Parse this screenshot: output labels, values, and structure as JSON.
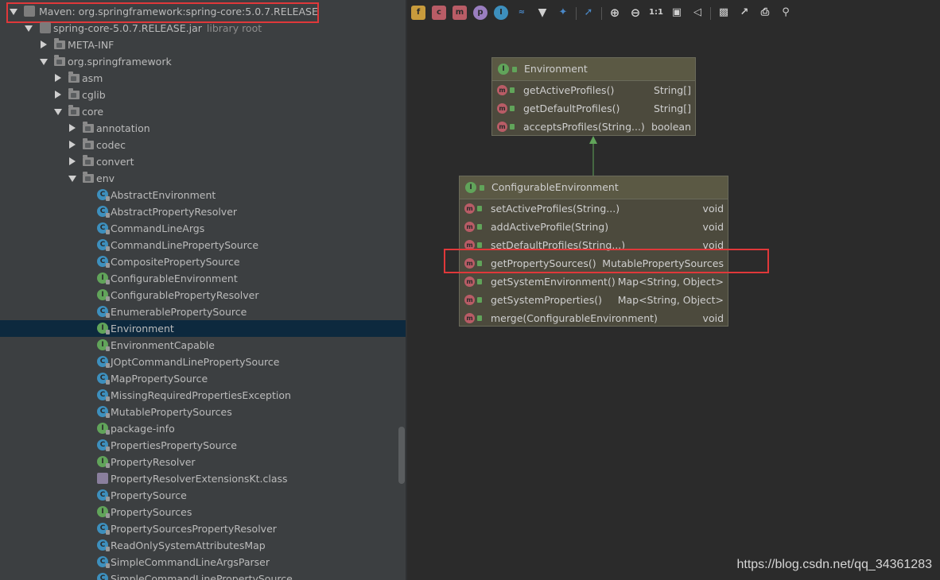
{
  "tree": {
    "root_label": "Maven: org.springframework:spring-core:5.0.7.RELEASE",
    "jar_label": "spring-core-5.0.7.RELEASE.jar",
    "jar_sub": "library root",
    "folders": {
      "meta_inf": "META-INF",
      "org_springframework": "org.springframework",
      "asm": "asm",
      "cglib": "cglib",
      "core": "core",
      "annotation": "annotation",
      "codec": "codec",
      "convert": "convert",
      "env": "env"
    },
    "env_items": [
      {
        "label": "AbstractEnvironment",
        "kind": "class"
      },
      {
        "label": "AbstractPropertyResolver",
        "kind": "class"
      },
      {
        "label": "CommandLineArgs",
        "kind": "class"
      },
      {
        "label": "CommandLinePropertySource",
        "kind": "class"
      },
      {
        "label": "CompositePropertySource",
        "kind": "class"
      },
      {
        "label": "ConfigurableEnvironment",
        "kind": "interface"
      },
      {
        "label": "ConfigurablePropertyResolver",
        "kind": "interface"
      },
      {
        "label": "EnumerablePropertySource",
        "kind": "class"
      },
      {
        "label": "Environment",
        "kind": "interface",
        "selected": true
      },
      {
        "label": "EnvironmentCapable",
        "kind": "interface"
      },
      {
        "label": "JOptCommandLinePropertySource",
        "kind": "class"
      },
      {
        "label": "MapPropertySource",
        "kind": "class"
      },
      {
        "label": "MissingRequiredPropertiesException",
        "kind": "class"
      },
      {
        "label": "MutablePropertySources",
        "kind": "class"
      },
      {
        "label": "package-info",
        "kind": "interface"
      },
      {
        "label": "PropertiesPropertySource",
        "kind": "class"
      },
      {
        "label": "PropertyResolver",
        "kind": "interface"
      },
      {
        "label": "PropertyResolverExtensionsKt.class",
        "kind": "kotlin"
      },
      {
        "label": "PropertySource",
        "kind": "class"
      },
      {
        "label": "PropertySources",
        "kind": "interface"
      },
      {
        "label": "PropertySourcesPropertyResolver",
        "kind": "class"
      },
      {
        "label": "ReadOnlySystemAttributesMap",
        "kind": "class"
      },
      {
        "label": "SimpleCommandLineArgsParser",
        "kind": "class"
      },
      {
        "label": "SimpleCommandLinePropertySource",
        "kind": "class"
      }
    ]
  },
  "toolbar": {
    "icons": [
      "fields-icon",
      "constructors-icon",
      "methods-icon",
      "properties-icon",
      "inner-classes-icon",
      "layout-icon",
      "filter-icon",
      "pin-icon",
      "edge-icon",
      "zoom-in-icon",
      "zoom-out-icon",
      "actual-size-icon",
      "fit-icon",
      "share-icon",
      "save-icon",
      "export-icon",
      "print-icon",
      "zoom-preview-icon"
    ],
    "actual_size_label": "1:1"
  },
  "diagram": {
    "environment": {
      "title": "Environment",
      "methods": [
        {
          "name": "getActiveProfiles()",
          "type": "String[]"
        },
        {
          "name": "getDefaultProfiles()",
          "type": "String[]"
        },
        {
          "name": "acceptsProfiles(String...)",
          "type": "boolean"
        }
      ]
    },
    "configurable": {
      "title": "ConfigurableEnvironment",
      "methods": [
        {
          "name": "setActiveProfiles(String...)",
          "type": "void"
        },
        {
          "name": "addActiveProfile(String)",
          "type": "void"
        },
        {
          "name": "setDefaultProfiles(String...)",
          "type": "void"
        },
        {
          "name": "getPropertySources()",
          "type": "MutablePropertySources"
        },
        {
          "name": "getSystemEnvironment()",
          "type": "Map<String, Object>"
        },
        {
          "name": "getSystemProperties()",
          "type": "Map<String, Object>"
        },
        {
          "name": "merge(ConfigurableEnvironment)",
          "type": "void"
        }
      ]
    },
    "icon_letters": {
      "method": "m",
      "interface": "I"
    }
  },
  "watermark": "https://blog.csdn.net/qq_34361283",
  "colors": {
    "highlight_box": "#e0383a",
    "selection": "#0d293e",
    "inherit_arrow": "#61a45a"
  }
}
